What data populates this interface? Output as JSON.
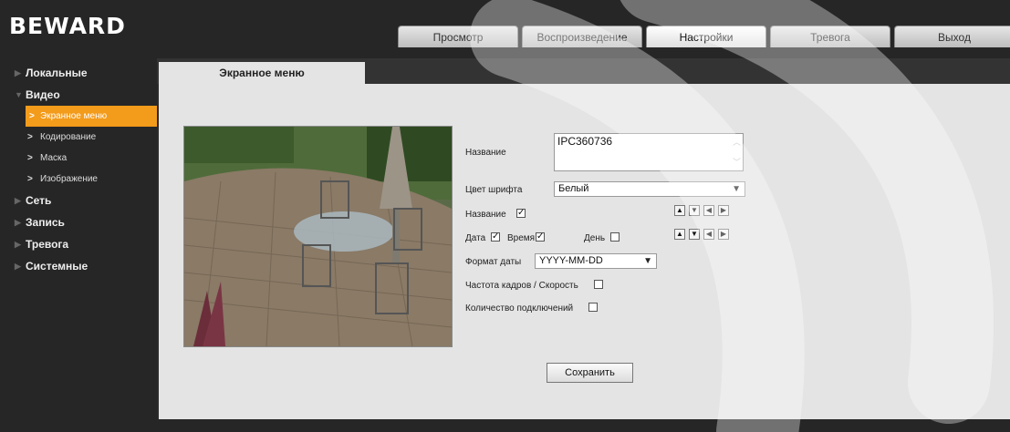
{
  "brand": {
    "logo_text": "BEWARD"
  },
  "top_tabs": [
    {
      "label": "Просмотр"
    },
    {
      "label": "Воспроизведение"
    },
    {
      "label": "Настройки",
      "active": true
    },
    {
      "label": "Тревога"
    },
    {
      "label": "Выход"
    }
  ],
  "sidebar": {
    "items": [
      {
        "label": "Локальные",
        "icon": "triangle-right-icon"
      },
      {
        "label": "Видео",
        "icon": "triangle-down-icon"
      },
      {
        "label": "Сеть",
        "icon": "triangle-right-icon"
      },
      {
        "label": "Запись",
        "icon": "triangle-right-icon"
      },
      {
        "label": "Тревога",
        "icon": "triangle-right-icon"
      },
      {
        "label": "Системные",
        "icon": "triangle-right-icon"
      }
    ],
    "video_subitems": [
      {
        "label": "Экранное меню",
        "active": true
      },
      {
        "label": "Кодирование"
      },
      {
        "label": "Маска"
      },
      {
        "label": "Изображение"
      }
    ],
    "active_color": "#f39b1b"
  },
  "page": {
    "tab_title": "Экранное меню"
  },
  "form": {
    "name_label": "Название",
    "name_value": "IPC360736",
    "font_color_label": "Цвет шрифта",
    "font_color_value": "Белый",
    "name_toggle_label": "Название",
    "name_checked": true,
    "date_label": "Дата",
    "date_checked": true,
    "time_label": "Время",
    "time_checked": true,
    "day_label": "День",
    "day_checked": false,
    "date_format_label": "Формат даты",
    "date_format_value": "YYYY-MM-DD",
    "fps_label": "Частота кадров / Скорость",
    "fps_checked": false,
    "connections_label": "Количество подключений",
    "connections_checked": false,
    "save_label": "Сохранить",
    "arrow_icons": [
      "arrow-up-icon",
      "arrow-down-icon",
      "arrow-left-icon",
      "arrow-right-icon"
    ]
  }
}
